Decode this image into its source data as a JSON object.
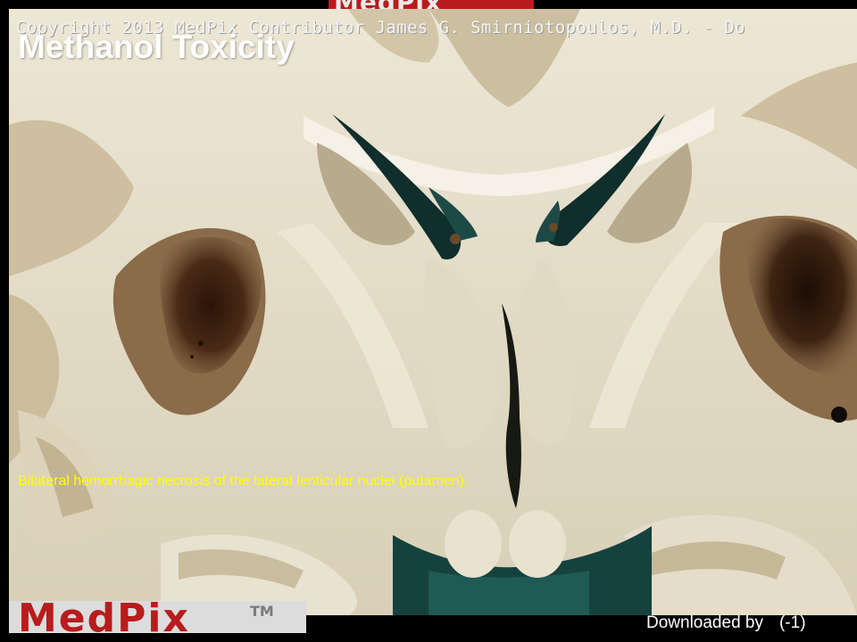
{
  "slide": {
    "copyright": "Copyright 2013 MedPix Contributor James G. Smirniotopoulos, M.D.  - Do",
    "title": "Methanol Toxicity",
    "caption": "Bilateral hemorrhagic necrosis of the lateral lenticular nuclei (putamen).",
    "footer": {
      "downloaded_label": "Downloaded by",
      "downloaded_value": "(-1)"
    },
    "logo_text": "MedPix",
    "logo_tm": "TM"
  },
  "colors": {
    "background": "#000000",
    "title": "#ffffff",
    "caption": "#ffff00",
    "logo_red": "#b81c1c"
  }
}
